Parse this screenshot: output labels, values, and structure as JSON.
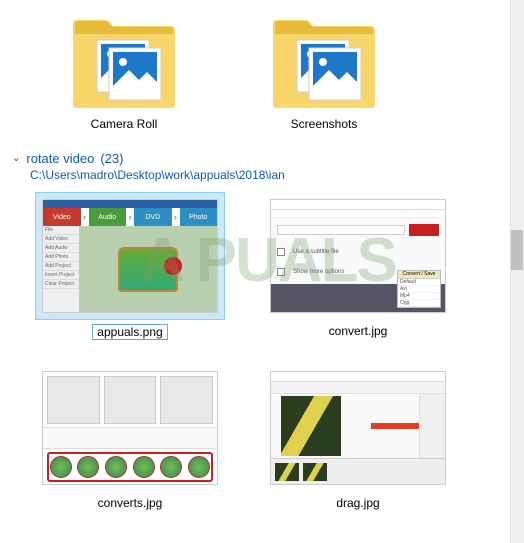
{
  "folders": [
    {
      "label": "Camera Roll"
    },
    {
      "label": "Screenshots"
    }
  ],
  "group": {
    "chevron": "⌄",
    "name": "rotate video",
    "count": "(23)",
    "path": "C:\\Users\\madro\\Desktop\\work\\appuals\\2018\\ian"
  },
  "thumbs": [
    {
      "label": "appuals.png",
      "selected": true
    },
    {
      "label": "convert.jpg",
      "selected": false
    },
    {
      "label": "converts.jpg",
      "selected": false
    },
    {
      "label": "drag.jpg",
      "selected": false
    }
  ],
  "appuals_tabs": {
    "v": "Video",
    "a": "Audio",
    "d": "DVD",
    "p": "Photo"
  },
  "appuals_side": [
    "File",
    "Add Video",
    "Add Audio",
    "Add Photo",
    "Add Project",
    "Insert Project",
    "Clear Project"
  ],
  "convert": {
    "subtitle": "Use a subtitle file",
    "more": "Show more options",
    "hdr": "Convert / Save",
    "opts": [
      "Default",
      "Avi",
      "Mp4",
      "Ogg"
    ]
  },
  "watermark": "A  PUALS"
}
